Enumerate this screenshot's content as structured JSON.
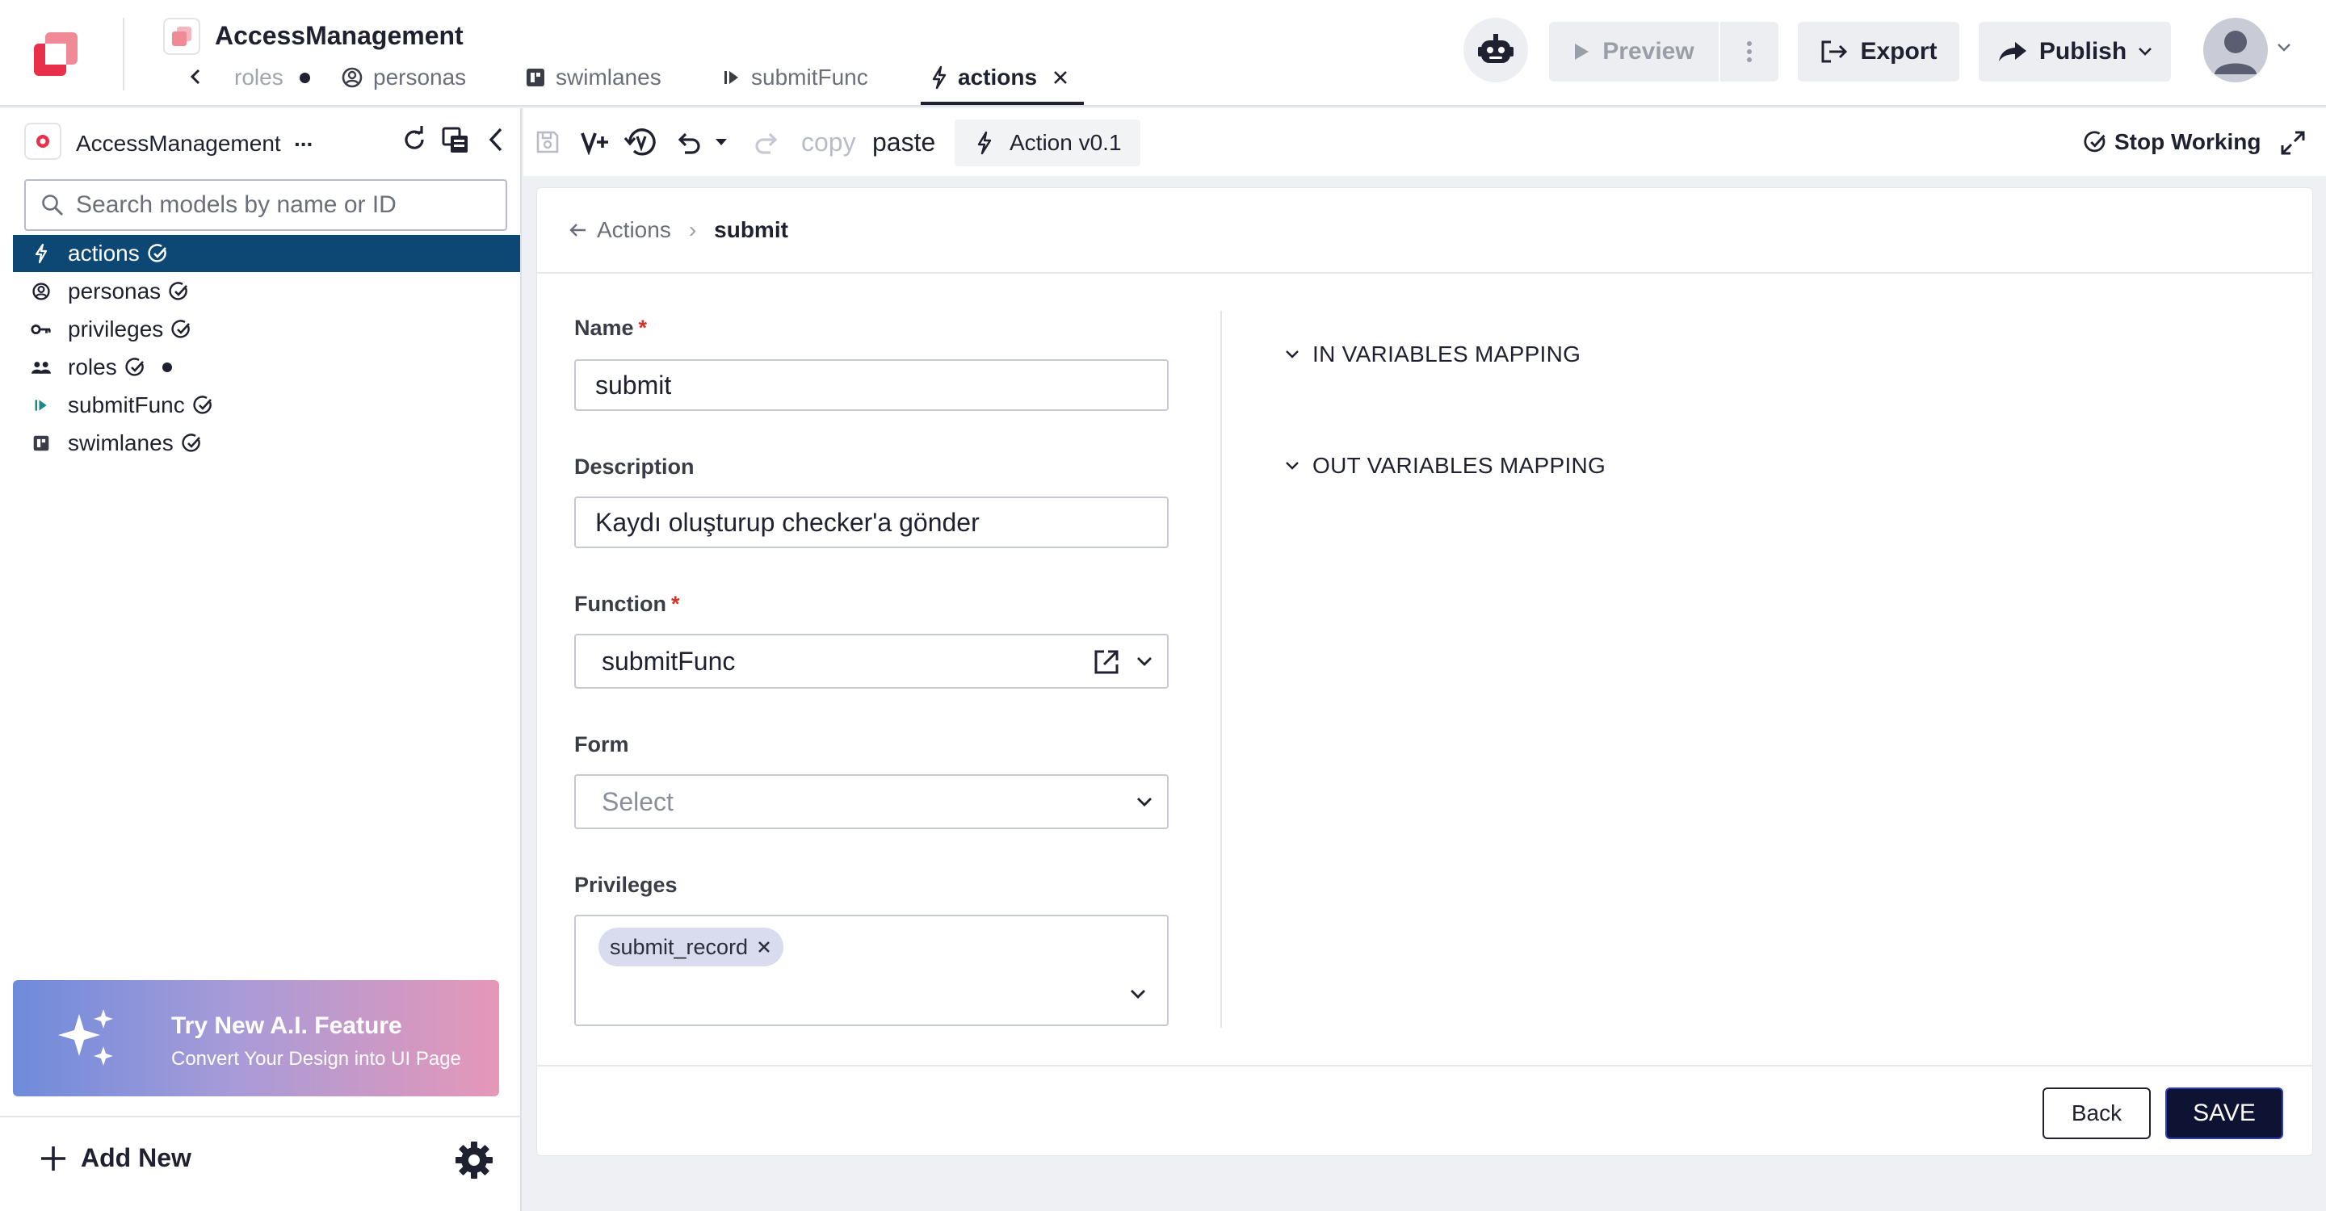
{
  "header": {
    "app_title": "AccessManagement",
    "tabs": [
      {
        "label": "roles",
        "icon": "none",
        "unsaved": true
      },
      {
        "label": "personas",
        "icon": "persona-icon"
      },
      {
        "label": "swimlanes",
        "icon": "swimlane-icon"
      },
      {
        "label": "submitFunc",
        "icon": "function-icon"
      },
      {
        "label": "actions",
        "icon": "lightning-icon",
        "active": true
      }
    ],
    "preview_label": "Preview",
    "export_label": "Export",
    "publish_label": "Publish"
  },
  "sidebar": {
    "title": "AccessManagement",
    "more": "...",
    "search_placeholder": "Search models by name or ID",
    "items": [
      {
        "label": "actions",
        "icon": "lightning-icon",
        "selected": true
      },
      {
        "label": "personas",
        "icon": "persona-icon"
      },
      {
        "label": "privileges",
        "icon": "key-icon"
      },
      {
        "label": "roles",
        "icon": "group-icon",
        "unsaved": true
      },
      {
        "label": "submitFunc",
        "icon": "function-icon"
      },
      {
        "label": "swimlanes",
        "icon": "swimlane-icon"
      }
    ],
    "ai_banner": {
      "title": "Try New A.I. Feature",
      "subtitle": "Convert Your Design into UI Page"
    },
    "add_new_label": "Add New"
  },
  "toolbar": {
    "copy_label": "copy",
    "paste_label": "paste",
    "action_label": "Action v0.1",
    "stop_working_label": "Stop Working"
  },
  "form": {
    "breadcrumb": {
      "parent": "Actions",
      "current": "submit"
    },
    "name_label": "Name",
    "name_value": "submit",
    "description_label": "Description",
    "description_value": "Kaydı oluşturup checker'a gönder",
    "function_label": "Function",
    "function_value": "submitFunc",
    "form_label": "Form",
    "form_placeholder": "Select",
    "privileges_label": "Privileges",
    "privileges_values": [
      "submit_record"
    ],
    "required_mark": "*",
    "in_mapping_label": "IN VARIABLES MAPPING",
    "out_mapping_label": "OUT VARIABLES MAPPING",
    "back_label": "Back",
    "save_label": "SAVE"
  },
  "colors": {
    "selected_bg": "#0d4874",
    "required": "#d93025",
    "save_bg": "#0e1333",
    "brand_red": "#e8304a"
  }
}
